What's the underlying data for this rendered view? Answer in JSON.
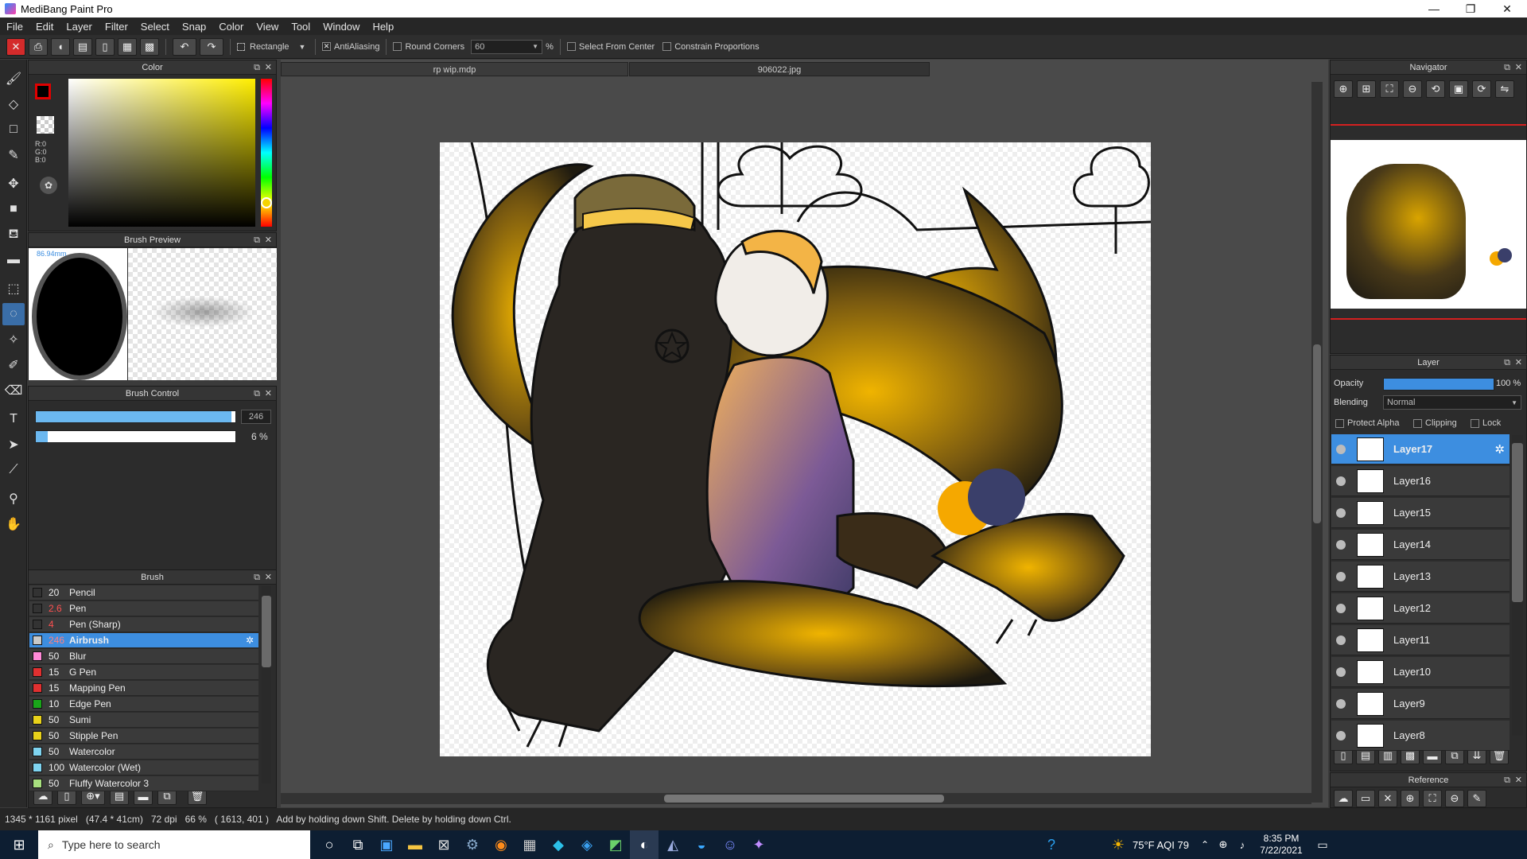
{
  "window": {
    "title": "MediBang Paint Pro",
    "minimize": "—",
    "maximize": "❐",
    "close": "✕"
  },
  "menu": [
    "File",
    "Edit",
    "Layer",
    "Filter",
    "Select",
    "Snap",
    "Color",
    "View",
    "Tool",
    "Window",
    "Help"
  ],
  "toolbar": {
    "shape": "Rectangle",
    "antialiasing": "AntiAliasing",
    "round_corners": "Round Corners",
    "round_value": "60",
    "percent": "%",
    "select_from_center": "Select From Center",
    "constrain": "Constrain Proportions"
  },
  "color_panel": {
    "title": "Color",
    "r": "R:0",
    "g": "G:0",
    "b": "B:0"
  },
  "brush_preview": {
    "title": "Brush Preview",
    "size_label": "86.94mm"
  },
  "brush_control": {
    "title": "Brush Control",
    "size_value": "246",
    "size_fill": 0.98,
    "opacity_value": "6 %",
    "opacity_fill": 0.06
  },
  "brush_panel": {
    "title": "Brush",
    "items": [
      {
        "size": "20",
        "name": "Pencil",
        "color": "#333333"
      },
      {
        "size": "2.6",
        "name": "Pen",
        "color": "#333333"
      },
      {
        "size": "4",
        "name": "Pen (Sharp)",
        "color": "#333333"
      },
      {
        "size": "246",
        "name": "Airbrush",
        "color": "#c9c9c9",
        "selected": true
      },
      {
        "size": "50",
        "name": "Blur",
        "color": "#ff8ad8"
      },
      {
        "size": "15",
        "name": "G Pen",
        "color": "#e03030"
      },
      {
        "size": "15",
        "name": "Mapping Pen",
        "color": "#e03030"
      },
      {
        "size": "10",
        "name": "Edge Pen",
        "color": "#19a519"
      },
      {
        "size": "50",
        "name": "Sumi",
        "color": "#e8d21a"
      },
      {
        "size": "50",
        "name": "Stipple Pen",
        "color": "#e8d21a"
      },
      {
        "size": "50",
        "name": "Watercolor",
        "color": "#7fd4f0"
      },
      {
        "size": "100",
        "name": "Watercolor (Wet)",
        "color": "#7fd4f0"
      },
      {
        "size": "50",
        "name": "Fluffy Watercolor 3",
        "color": "#a8e07f"
      }
    ]
  },
  "tabs": [
    {
      "label": "rp wip.mdp"
    },
    {
      "label": "906022.jpg"
    }
  ],
  "navigator": {
    "title": "Navigator"
  },
  "layer_panel": {
    "title": "Layer",
    "opacity_label": "Opacity",
    "opacity_value": "100 %",
    "opacity_fill": 1.0,
    "blending_label": "Blending",
    "blending_value": "Normal",
    "protect_alpha": "Protect Alpha",
    "clipping": "Clipping",
    "lock": "Lock",
    "layers": [
      "Layer17",
      "Layer16",
      "Layer15",
      "Layer14",
      "Layer13",
      "Layer12",
      "Layer11",
      "Layer10",
      "Layer9",
      "Layer8"
    ]
  },
  "reference": {
    "title": "Reference"
  },
  "status": {
    "text": "1345 * 1161 pixel   (47.4 * 41cm)   72 dpi   66 %   ( 1613, 401 )   Add by holding down Shift. Delete by holding down Ctrl."
  },
  "taskbar": {
    "search_placeholder": "Type here to search",
    "weather": "75°F  AQI 79",
    "time": "8:35 PM",
    "date": "7/22/2021"
  },
  "colors": {
    "accent": "#3d8ee0",
    "gold": "#f5a800",
    "navy": "#3a3f6a"
  }
}
